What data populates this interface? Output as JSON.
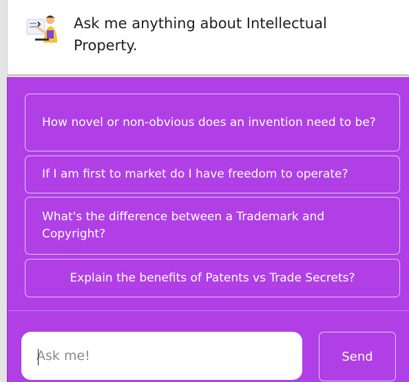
{
  "header": {
    "avatar_icon": "assistant-avatar-icon",
    "greeting": "Ask me anything about Intellectual Property."
  },
  "suggestions": [
    {
      "label": "How novel or non-obvious does an invention need to be?"
    },
    {
      "label": "If I am first to market do I have freedom to operate?"
    },
    {
      "label": "What's the difference between a Trademark and Copyright?"
    },
    {
      "label": "Explain the benefits of Patents vs Trade Secrets?"
    }
  ],
  "composer": {
    "placeholder": "Ask me!",
    "value": "",
    "send_label": "Send"
  },
  "colors": {
    "panel": "#b03fe6",
    "button_border": "#e7c6f7",
    "text_light": "#ffffff"
  }
}
